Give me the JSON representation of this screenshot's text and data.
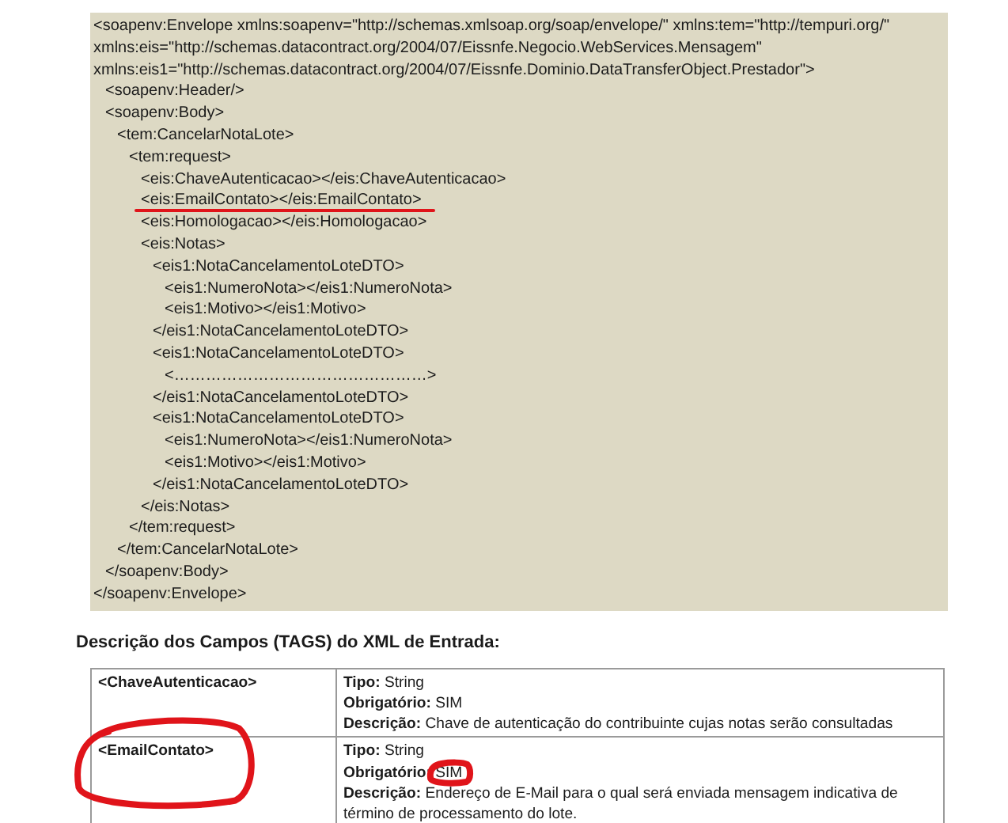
{
  "xml_sample": [
    {
      "open": [
        "<soapenv:Envelope xmlns:soapenv=\"http://schemas.xmlsoap.org/soap/envelope/\" xmlns:tem=\"http://tempuri.org/\"",
        "xmlns:eis=\"http://schemas.datacontract.org/2004/07/Eissnfe.Negocio.WebServices.Mensagem\"",
        "xmlns:eis1=\"http://schemas.datacontract.org/2004/07/Eissnfe.Dominio.DataTransferObject.Prestador\">"
      ],
      "close": "</soapenv:Envelope>",
      "children": [
        {
          "open": [
            "<soapenv:Header/>"
          ]
        },
        {
          "open": [
            "<soapenv:Body>"
          ],
          "close": "</soapenv:Body>",
          "children": [
            {
              "open": [
                "<tem:CancelarNotaLote>"
              ],
              "close": "</tem:CancelarNotaLote>",
              "children": [
                {
                  "open": [
                    "<tem:request>"
                  ],
                  "close": "</tem:request>",
                  "children": [
                    {
                      "open": [
                        "<eis:ChaveAutenticacao></eis:ChaveAutenticacao>"
                      ]
                    },
                    {
                      "open": [
                        "<eis:EmailContato></eis:EmailContato>"
                      ],
                      "underlined": true
                    },
                    {
                      "open": [
                        "<eis:Homologacao></eis:Homologacao>"
                      ]
                    },
                    {
                      "open": [
                        "<eis:Notas>"
                      ],
                      "close": "</eis:Notas>",
                      "children": [
                        {
                          "open": [
                            "<eis1:NotaCancelamentoLoteDTO>"
                          ],
                          "close": "</eis1:NotaCancelamentoLoteDTO>",
                          "children": [
                            {
                              "open": [
                                "<eis1:NumeroNota></eis1:NumeroNota>"
                              ]
                            },
                            {
                              "open": [
                                "<eis1:Motivo></eis1:Motivo>"
                              ]
                            }
                          ]
                        },
                        {
                          "open": [
                            "<eis1:NotaCancelamentoLoteDTO>"
                          ],
                          "close": "</eis1:NotaCancelamentoLoteDTO>",
                          "children": [
                            {
                              "open": [
                                "<…………………………………………>"
                              ]
                            }
                          ]
                        },
                        {
                          "open": [
                            "<eis1:NotaCancelamentoLoteDTO>"
                          ],
                          "close": "</eis1:NotaCancelamentoLoteDTO>",
                          "children": [
                            {
                              "open": [
                                "<eis1:NumeroNota></eis1:NumeroNota>"
                              ]
                            },
                            {
                              "open": [
                                "<eis1:Motivo></eis1:Motivo>"
                              ]
                            }
                          ]
                        }
                      ]
                    }
                  ]
                }
              ]
            }
          ]
        }
      ]
    }
  ],
  "fields_heading": "Descrição dos Campos (TAGS) do XML de Entrada:",
  "fields": [
    {
      "tag": "<ChaveAutenticacao>",
      "circled": false,
      "details": [
        {
          "label": "Tipo:",
          "value": "String",
          "circled": false
        },
        {
          "label": "Obrigatório:",
          "value": "SIM",
          "circled": false
        },
        {
          "label": "Descrição:",
          "value": "Chave de autenticação do contribuinte cujas notas serão consultadas",
          "circled": false
        }
      ]
    },
    {
      "tag": "<EmailContato>",
      "circled": true,
      "details": [
        {
          "label": "Tipo:",
          "value": "String",
          "circled": false
        },
        {
          "label": "Obrigatório:",
          "value": "SIM",
          "circled": true
        },
        {
          "label": "Descrição:",
          "value": "Endereço de E-Mail para o qual será enviada mensagem indicativa de término de processamento do lote.",
          "circled": false
        }
      ]
    }
  ]
}
